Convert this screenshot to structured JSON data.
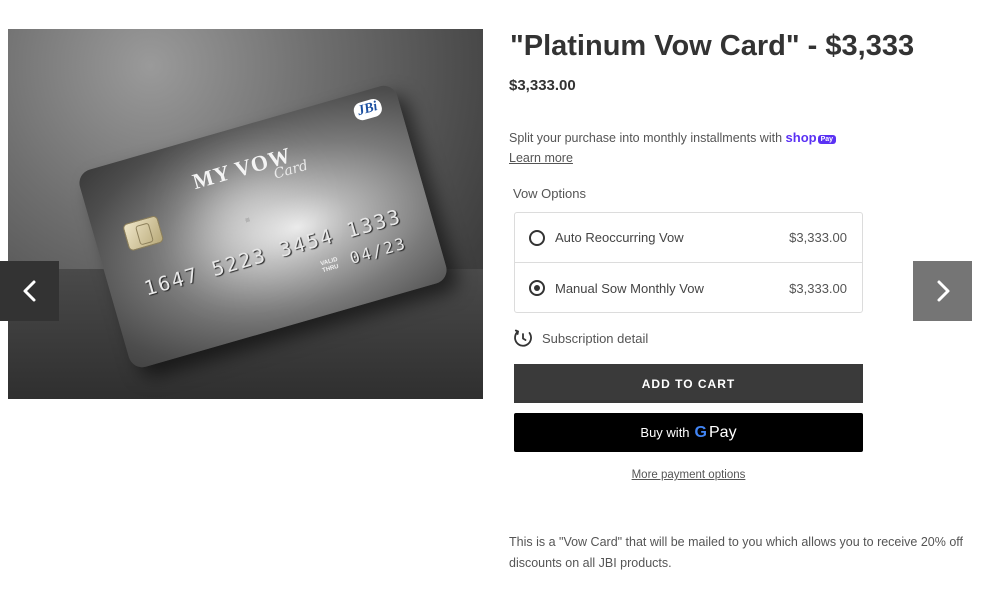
{
  "product": {
    "title": "\"Platinum Vow Card\" - $3,333",
    "price": "$3,333.00",
    "description": "This is a \"Vow Card\" that will be mailed to you which allows you to receive 20% off discounts on all JBI products."
  },
  "gallery": {
    "card": {
      "brand": "MY VOW",
      "brand_script": "Card",
      "logo": "JBi",
      "number": "1647 5223 3454 1333",
      "valid_label_1": "VALID",
      "valid_label_2": "THRU",
      "expiry": "04/23"
    },
    "prev_icon": "chevron-left-icon",
    "next_icon": "chevron-right-icon"
  },
  "installments": {
    "text": "Split your purchase into monthly installments with",
    "brand": "shop",
    "badge": "Pay",
    "learn_more": "Learn more"
  },
  "options": {
    "label": "Vow Options",
    "items": [
      {
        "name": "Auto Reoccurring Vow",
        "price": "$3,333.00",
        "selected": false
      },
      {
        "name": "Manual Sow Monthly Vow",
        "price": "$3,333.00",
        "selected": true
      }
    ]
  },
  "subscription": {
    "icon": "subscription-clock-icon",
    "label": "Subscription detail"
  },
  "buttons": {
    "add_to_cart": "ADD TO CART",
    "gpay_prefix": "Buy with",
    "gpay_g": "G",
    "gpay_word": "Pay",
    "more_payment": "More payment options"
  },
  "colors": {
    "shop_pay": "#5a31f4",
    "add_to_cart_bg": "#3a3a3a",
    "gpay_bg": "#000000"
  }
}
